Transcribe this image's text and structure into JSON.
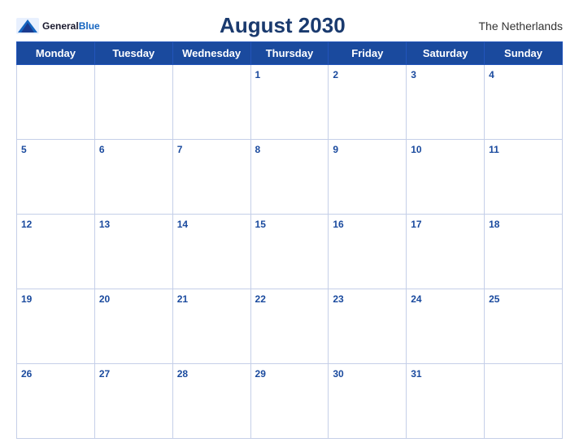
{
  "header": {
    "title": "August 2030",
    "country": "The Netherlands",
    "logo": {
      "general": "General",
      "blue": "Blue"
    }
  },
  "weekdays": [
    "Monday",
    "Tuesday",
    "Wednesday",
    "Thursday",
    "Friday",
    "Saturday",
    "Sunday"
  ],
  "weeks": [
    [
      null,
      null,
      null,
      1,
      2,
      3,
      4
    ],
    [
      5,
      6,
      7,
      8,
      9,
      10,
      11
    ],
    [
      12,
      13,
      14,
      15,
      16,
      17,
      18
    ],
    [
      19,
      20,
      21,
      22,
      23,
      24,
      25
    ],
    [
      26,
      27,
      28,
      29,
      30,
      31,
      null
    ]
  ]
}
